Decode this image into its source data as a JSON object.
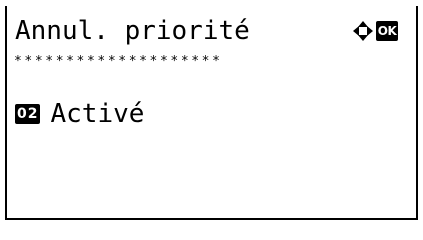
{
  "screen": {
    "title": "Annul. priorité",
    "nav_icon": "four-way-arrow-icon",
    "ok_label": "OK",
    "divider": "********************"
  },
  "menu": {
    "items": [
      {
        "number": "02",
        "label": "Activé"
      }
    ]
  }
}
